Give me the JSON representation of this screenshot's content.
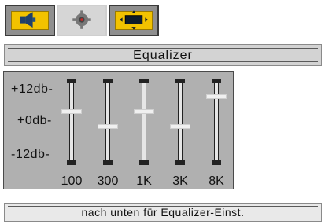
{
  "tabs": [
    {
      "icon": "speaker-icon",
      "active": true
    },
    {
      "icon": "settings-gear-icon",
      "active": false
    },
    {
      "icon": "screen-aspect-icon",
      "active": true
    }
  ],
  "title": "Equalizer",
  "db_scale": {
    "top": "+12db-",
    "mid": "+0db-",
    "bottom": "-12db-"
  },
  "bands": [
    {
      "label": "100",
      "level_db": 4
    },
    {
      "label": "300",
      "level_db": -1
    },
    {
      "label": "1K",
      "level_db": 4
    },
    {
      "label": "3K",
      "level_db": -1
    },
    {
      "label": "8K",
      "level_db": 9
    }
  ],
  "hint": "nach unten für Equalizer-Einst.",
  "colors": {
    "accent": "#f2c200",
    "panel": "#b0b0b0",
    "bar": "#d3d3d3"
  }
}
